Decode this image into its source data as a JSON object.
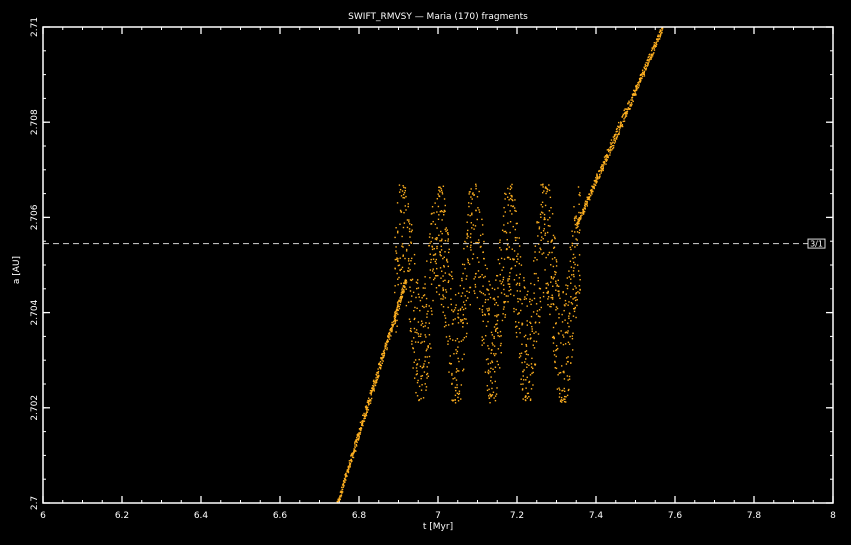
{
  "chart_data": {
    "type": "scatter",
    "title": "SWIFT_RMVSY — Maria (170) fragments",
    "xlabel": "t [Myr]",
    "ylabel": "a [AU]",
    "xlim": [
      6,
      8
    ],
    "ylim": [
      2.7,
      2.71
    ],
    "xticks": [
      6,
      6.2,
      6.4,
      6.6,
      6.8,
      7,
      7.2,
      7.4,
      7.6,
      7.8,
      8
    ],
    "xtick_labels": [
      "6",
      "6.2",
      "6.4",
      "6.6",
      "6.8",
      "7",
      "7.2",
      "7.4",
      "7.6",
      "7.8",
      "8"
    ],
    "yticks": [
      2.7,
      2.702,
      2.704,
      2.706,
      2.708,
      2.71
    ],
    "ytick_labels": [
      "2.7",
      "2.702",
      "2.704",
      "2.706",
      "2.708",
      "2.71"
    ],
    "resonance": {
      "a": 2.70545,
      "label": "3/1"
    },
    "drift_segments": [
      {
        "t": [
          6.745,
          6.92
        ],
        "a": [
          2.69995,
          2.7047
        ]
      },
      {
        "t": [
          7.35,
          7.57
        ],
        "a": [
          2.7058,
          2.71
        ]
      }
    ],
    "trapped_cloud": {
      "t": [
        6.89,
        7.36
      ],
      "a_min": 2.7021,
      "a_max": 2.7067
    },
    "colors": {
      "points": "#ffb020",
      "axes": "#ffffff",
      "resonance_line": "#bbbbbb"
    }
  }
}
